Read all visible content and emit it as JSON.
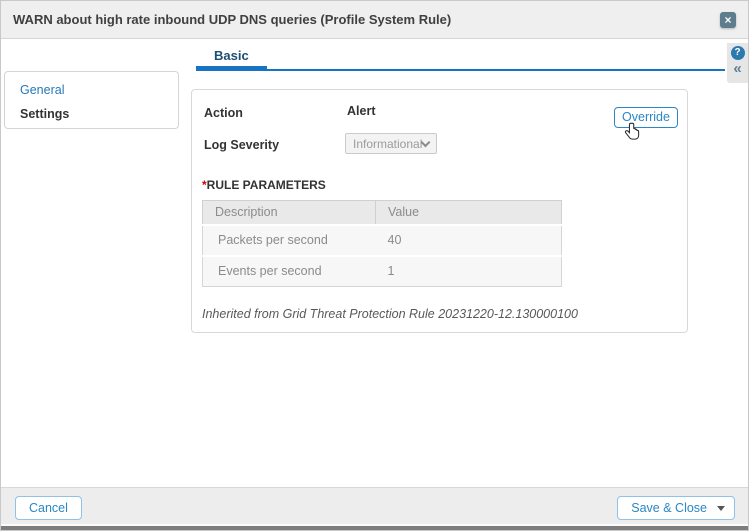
{
  "dialog": {
    "title": "WARN about high rate inbound UDP DNS queries (Profile System Rule)",
    "close_glyph": "×"
  },
  "tabs": {
    "items": [
      {
        "label": "Basic",
        "active": true
      }
    ]
  },
  "help": {
    "help_glyph": "?",
    "collapse_glyph": "«"
  },
  "sidebar": {
    "items": [
      {
        "label": "General",
        "selected": false
      },
      {
        "label": "Settings",
        "selected": true
      }
    ]
  },
  "form": {
    "action_label": "Action",
    "action_value": "Alert",
    "override_label": "Override",
    "log_severity_label": "Log Severity",
    "log_severity_value": "Informational",
    "section_required_mark": "*",
    "section_title": "RULE PARAMETERS",
    "table": {
      "headers": [
        "Description",
        "Value"
      ],
      "rows": [
        [
          "Packets per second",
          "40"
        ],
        [
          "Events per second",
          "1"
        ]
      ]
    },
    "inherited_note": "Inherited from Grid Threat Protection Rule 20231220-12.130000100"
  },
  "footer": {
    "cancel_label": "Cancel",
    "save_close_label": "Save & Close"
  },
  "colors": {
    "accent_blue": "#2a87c7",
    "tab_underline_blue": "#1873c4",
    "tab_text_blue": "#1c4e74",
    "link_blue": "#2779b5",
    "required_red": "#cc0000",
    "close_button_slate": "#5d7d8d",
    "footer_button_border": "#8fc1e9",
    "disabled_field_text": "#9b9b9b"
  }
}
